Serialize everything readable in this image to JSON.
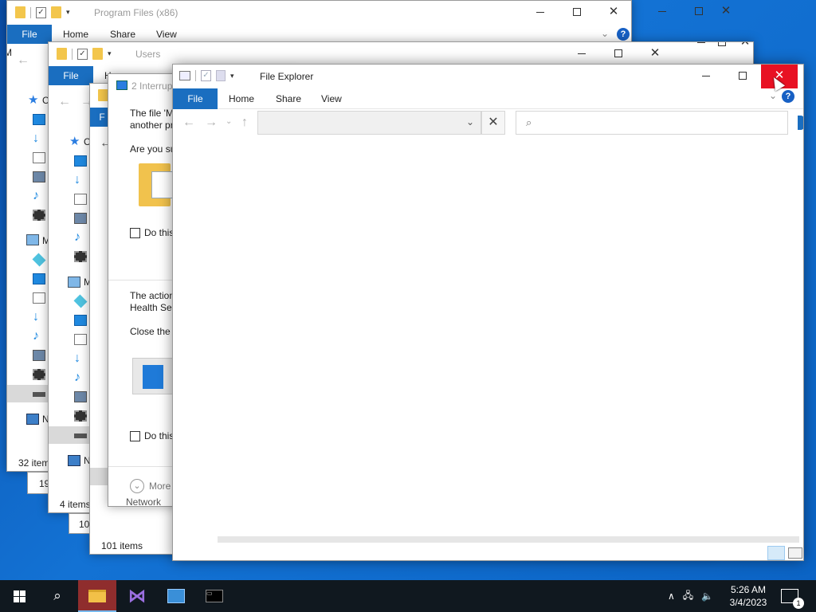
{
  "windows": {
    "program_files": {
      "title": "Program Files (x86)",
      "tabs": [
        "File",
        "Home",
        "Share",
        "View"
      ],
      "nav_cut": "M",
      "sidebar_cut": [
        "C",
        "M",
        "N"
      ],
      "status": "32 item",
      "status2": "19"
    },
    "third": {
      "status2": "10"
    },
    "users": {
      "title": "Users",
      "tabs": [
        "File",
        "H"
      ],
      "sidebar_cut": [
        "C",
        "M",
        "N"
      ],
      "status": "4 items"
    },
    "conflict_dialog": {
      "title": "2 Interrup",
      "tab_cut": "F",
      "msg1_line1": "The file 'M",
      "msg1_line2": "another pr",
      "question": "Are you su",
      "do_this_1": "Do this",
      "msg2_line1": "The action",
      "msg2_line2": "Health Ser",
      "close_the": "Close the",
      "do_this_2": "Do this",
      "more": "More",
      "network": "Network",
      "status": "101 items"
    },
    "file_explorer": {
      "title": "File Explorer",
      "tabs": [
        "File",
        "Home",
        "Share",
        "View"
      ],
      "search_placeholder": "",
      "address_value": ""
    }
  },
  "taskbar": {
    "apps": [
      "start-button",
      "search-button",
      "file-explorer",
      "visual-studio",
      "control-panel",
      "command-prompt"
    ],
    "time": "5:26 AM",
    "date": "3/4/2023",
    "notification_count": "1"
  },
  "colors": {
    "accent": "#1a6ec0",
    "close_hover": "#e81123",
    "taskbar": "#10181f",
    "desktop": "#0b63c4"
  }
}
